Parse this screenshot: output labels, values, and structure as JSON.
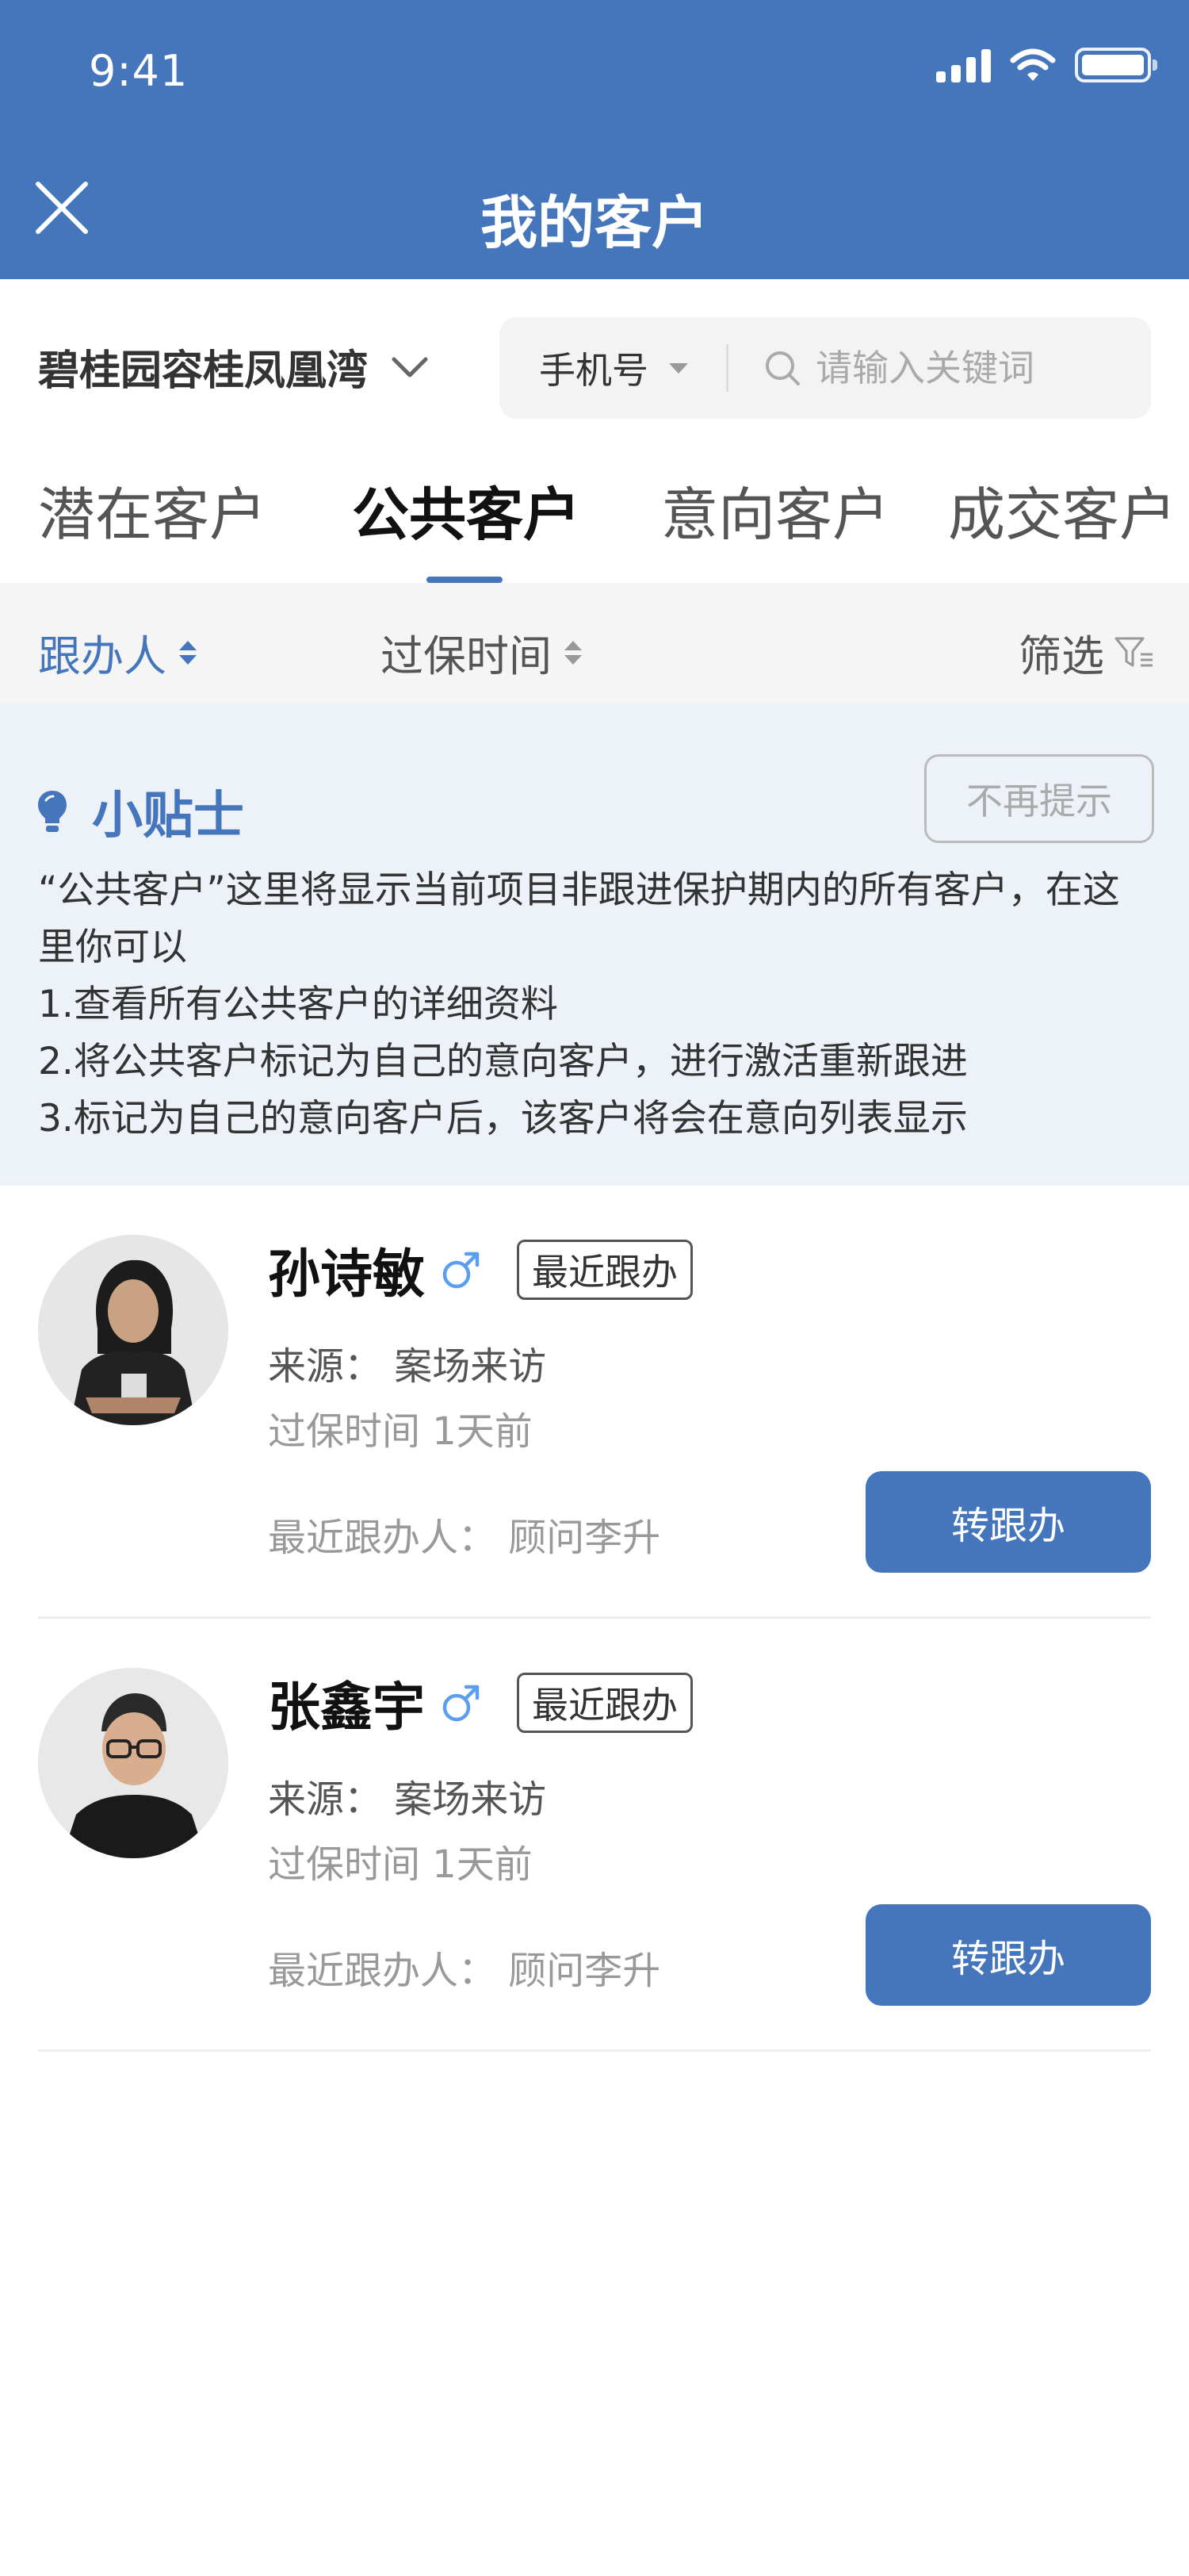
{
  "status_bar": {
    "time": "9:41"
  },
  "header": {
    "title": "我的客户"
  },
  "project": {
    "name": "碧桂园容桂凤凰湾"
  },
  "search": {
    "type_label": "手机号",
    "placeholder": "请输入关键词"
  },
  "tabs": [
    {
      "label": "潜在客户",
      "active": false
    },
    {
      "label": "公共客户",
      "active": true
    },
    {
      "label": "意向客户",
      "active": false
    },
    {
      "label": "成交客户",
      "active": false
    }
  ],
  "sort_bar": {
    "handler": "跟办人",
    "expire_time": "过保时间",
    "filter": "筛选"
  },
  "tip": {
    "title": "小贴士",
    "dismiss_label": "不再提示",
    "lines": [
      "“公共客户”这里将显示当前项目非跟进保护期内的所有客户，在这里你可以",
      "1.查看所有公共客户的详细资料",
      "2.将公共客户标记为自己的意向客户，进行激活重新跟进",
      "3.标记为自己的意向客户后，该客户将会在意向列表显示"
    ]
  },
  "customers": [
    {
      "name": "孙诗敏",
      "gender_icon": "male-icon",
      "tag": "最近跟办",
      "source": "来源：  案场来访",
      "expire": "过保时间 1天前",
      "follower": "最近跟办人：  顾问李升",
      "button": "转跟办"
    },
    {
      "name": "张鑫宇",
      "gender_icon": "male-icon",
      "tag": "最近跟办",
      "source": "来源：  案场来访",
      "expire": "过保时间 1天前",
      "follower": "最近跟办人：  顾问李升",
      "button": "转跟办"
    }
  ],
  "colors": {
    "primary": "#4576bc",
    "tip_bg": "#edf1f8",
    "sortbar_bg": "#f5f5f5"
  }
}
